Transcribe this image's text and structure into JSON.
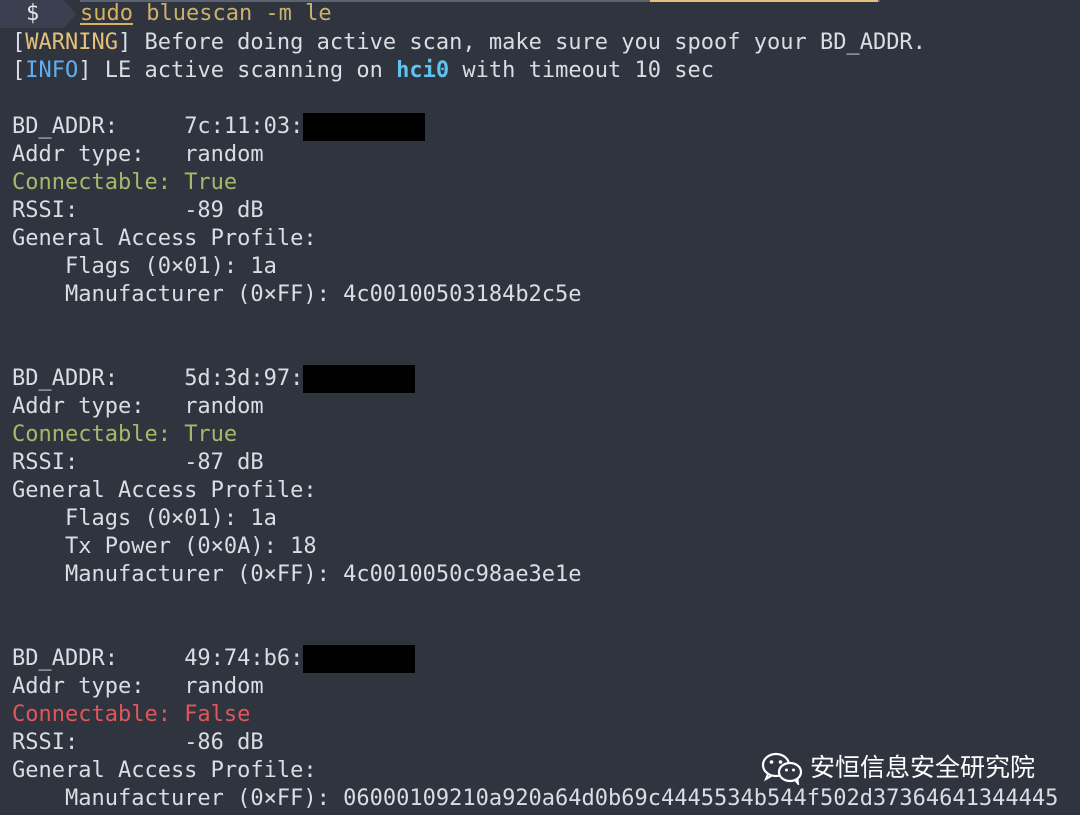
{
  "terminal": {
    "prompt": "$",
    "command_sudo": "sudo",
    "command_rest": " bluescan -m le",
    "warning": {
      "open": "[",
      "tag": "WARNING",
      "close": "]",
      "text": " Before doing active scan, make sure you spoof your BD_ADDR."
    },
    "info": {
      "open": "[",
      "tag": "INFO",
      "close": "]",
      "text_a": " LE active scanning on ",
      "iface": "hci0",
      "text_b": " with timeout 10 sec"
    }
  },
  "devices": [
    {
      "bd_addr_label": "BD_ADDR:     ",
      "bd_addr": "7c:11:03:",
      "addr_type_label": "Addr type:   ",
      "addr_type": "random",
      "connectable_label": "Connectable: ",
      "connectable": "True",
      "rssi_label": "RSSI:        ",
      "rssi": "-89 dB",
      "gap_label": "General Access Profile:",
      "fields": [
        "    Flags (0×01): 1a",
        "    Manufacturer (0×FF): 4c00100503184b2c5e"
      ]
    },
    {
      "bd_addr_label": "BD_ADDR:     ",
      "bd_addr": "5d:3d:97:",
      "addr_type_label": "Addr type:   ",
      "addr_type": "random",
      "connectable_label": "Connectable: ",
      "connectable": "True",
      "rssi_label": "RSSI:        ",
      "rssi": "-87 dB",
      "gap_label": "General Access Profile:",
      "fields": [
        "    Flags (0×01): 1a",
        "    Tx Power (0×0A): 18",
        "    Manufacturer (0×FF): 4c0010050c98ae3e1e"
      ]
    },
    {
      "bd_addr_label": "BD_ADDR:     ",
      "bd_addr": "49:74:b6:",
      "addr_type_label": "Addr type:   ",
      "addr_type": "random",
      "connectable_label": "Connectable: ",
      "connectable": "False",
      "rssi_label": "RSSI:        ",
      "rssi": "-86 dB",
      "gap_label": "General Access Profile:",
      "fields": [
        "    Manufacturer (0×FF): 06000109210a920a64d0b69c4445534b544f502d37364641344445"
      ]
    }
  ],
  "watermark": {
    "icon": "wechat-icon",
    "text": "安恒信息安全研究院"
  },
  "colors": {
    "background": "#2f343f",
    "text": "#d9dde4",
    "warning": "#e5c07b",
    "info": "#61afef",
    "connectable_true": "#a6b96b",
    "connectable_false": "#e0565b"
  }
}
